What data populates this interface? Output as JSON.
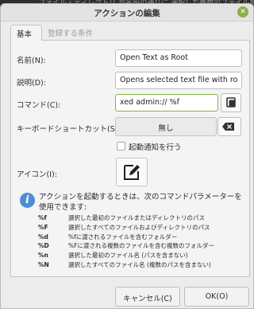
{
  "background": {
    "strip_text": "ファイル・ディレクトリ が名前の通りに 選択した複数のファイルを含む"
  },
  "window": {
    "title": "アクションの編集"
  },
  "tabs": [
    {
      "label": "基本",
      "active": true
    },
    {
      "label": "登録する条件",
      "active": false
    }
  ],
  "form": {
    "name_label": "名前(N):",
    "name_value": "Open Text as Root",
    "description_label": "説明(D):",
    "description_value": "Opens selected text file with ro",
    "command_label": "コマンド(C):",
    "command_value": "xed admin:// %f",
    "shortcut_label": "キーボードショートカット(S):",
    "shortcut_value": "無し",
    "startup_notify_label": "起動通知を行う",
    "startup_notify_checked": false,
    "icon_label": "アイコン(I):"
  },
  "help": {
    "intro": "アクションを起動するときは、次のコマンドパラメーターを使用できます:",
    "params": [
      {
        "code": "%f",
        "desc": "選択した最初のファイルまたはディレクトリのパス"
      },
      {
        "code": "%F",
        "desc": "選択したすべてのファイルおよびディレクトリのパス"
      },
      {
        "code": "%d",
        "desc": "%fに渡されるファイルを含むフォルダー"
      },
      {
        "code": "%D",
        "desc": "%Fに渡される複数のファイルを含む複数のフォルダー"
      },
      {
        "code": "%n",
        "desc": "選択した最初のファイル名 (パスを含まない)"
      },
      {
        "code": "%N",
        "desc": "選択したすべてのファイル名 (複数のパスを含まない)"
      }
    ]
  },
  "buttons": {
    "cancel": "キャンセル(C)",
    "ok": "OK(O)"
  },
  "colors": {
    "accent_green": "#86b04a",
    "close_green": "#8ab14a",
    "info_blue": "#4a8ed3"
  }
}
